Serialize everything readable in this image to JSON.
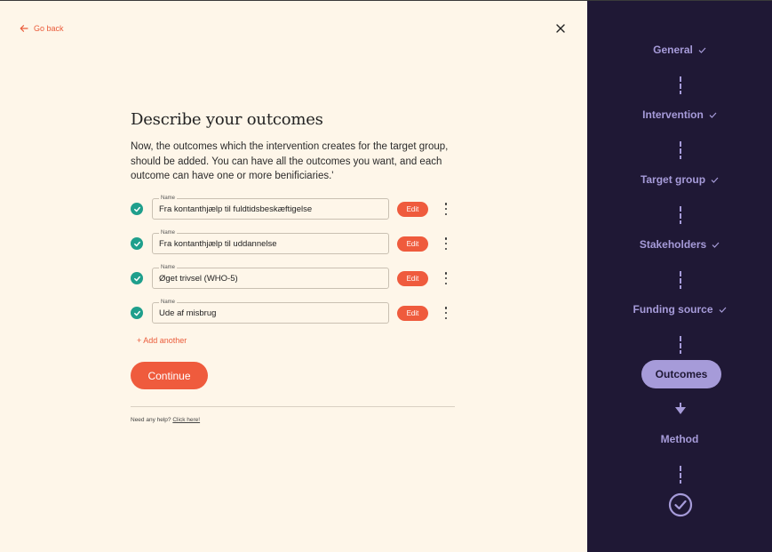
{
  "nav": {
    "go_back": "Go back"
  },
  "main": {
    "title": "Describe your outcomes",
    "description": "Now, the outcomes which the intervention creates for the target group, should be added. You can have all the outcomes you want, and each outcome can have one or more benificiaries.'",
    "field_label": "Name",
    "outcomes": [
      {
        "name": "Fra kontanthjælp til fuldtidsbeskæftigelse",
        "edit": "Edit"
      },
      {
        "name": "Fra kontanthjælp til uddannelse",
        "edit": "Edit"
      },
      {
        "name": "Øget trivsel (WHO-5)",
        "edit": "Edit"
      },
      {
        "name": "Ude af misbrug",
        "edit": "Edit"
      }
    ],
    "add_another": "+ Add another",
    "continue": "Continue",
    "help_text": "Need any help?",
    "help_link": "Click here!"
  },
  "steps": {
    "items": [
      {
        "label": "General",
        "state": "done"
      },
      {
        "label": "Intervention",
        "state": "done"
      },
      {
        "label": "Target group",
        "state": "done"
      },
      {
        "label": "Stakeholders",
        "state": "done"
      },
      {
        "label": "Funding source",
        "state": "done"
      },
      {
        "label": "Outcomes",
        "state": "active"
      },
      {
        "label": "Method",
        "state": "pending"
      }
    ]
  },
  "colors": {
    "accent": "#ef5b3d",
    "check": "#1f9f8c",
    "sidebar_bg": "#1f1835",
    "sidebar_text": "#a69bd9",
    "page_bg": "#fef6e9"
  }
}
